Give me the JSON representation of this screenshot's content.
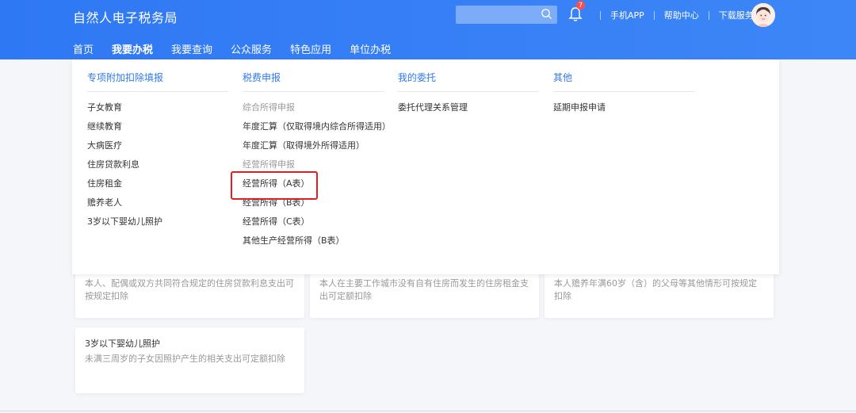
{
  "header": {
    "title": "自然人电子税务局",
    "search_placeholder": "",
    "notification_count": "7",
    "links": [
      "手机APP",
      "帮助中心",
      "下载服务"
    ]
  },
  "nav": {
    "items": [
      "首页",
      "我要办税",
      "我要查询",
      "公众服务",
      "特色应用",
      "单位办税"
    ],
    "active": "我要办税"
  },
  "dropdown": {
    "col1": {
      "head": "专项附加扣除填报",
      "items": [
        "子女教育",
        "继续教育",
        "大病医疗",
        "住房贷款利息",
        "住房租金",
        "赡养老人",
        "3岁以下婴幼儿照护"
      ]
    },
    "col2": {
      "head": "税费申报",
      "group1": "综合所得申报",
      "items1": [
        "年度汇算（仅取得境内综合所得适用）",
        "年度汇算（取得境外所得适用）"
      ],
      "group2": "经营所得申报",
      "items2": [
        "经营所得（A表）",
        "经营所得（B表）",
        "经营所得（C表）",
        "其他生产经营所得（B表）"
      ]
    },
    "col3": {
      "head": "我的委托",
      "items": [
        "委托代理关系管理"
      ]
    },
    "col4": {
      "head": "其他",
      "items": [
        "延期申报申请"
      ]
    }
  },
  "cards": {
    "c1_desc": "本人、配偶或双方共同符合规定的住房贷款利息支出可按规定扣除",
    "c2_desc": "本人在主要工作城市没有自有住房而发生的住房租金支出可定额扣除",
    "c3_desc": "本人赡养年满60岁（含）的父母等其他情形可按规定扣除",
    "c4_title": "3岁以下婴幼儿照护",
    "c4_desc": "未满三周岁的子女因照护产生的相关支出可定额扣除"
  },
  "colors": {
    "header_blue": "#2f78f4",
    "highlight_red": "#e02020"
  }
}
